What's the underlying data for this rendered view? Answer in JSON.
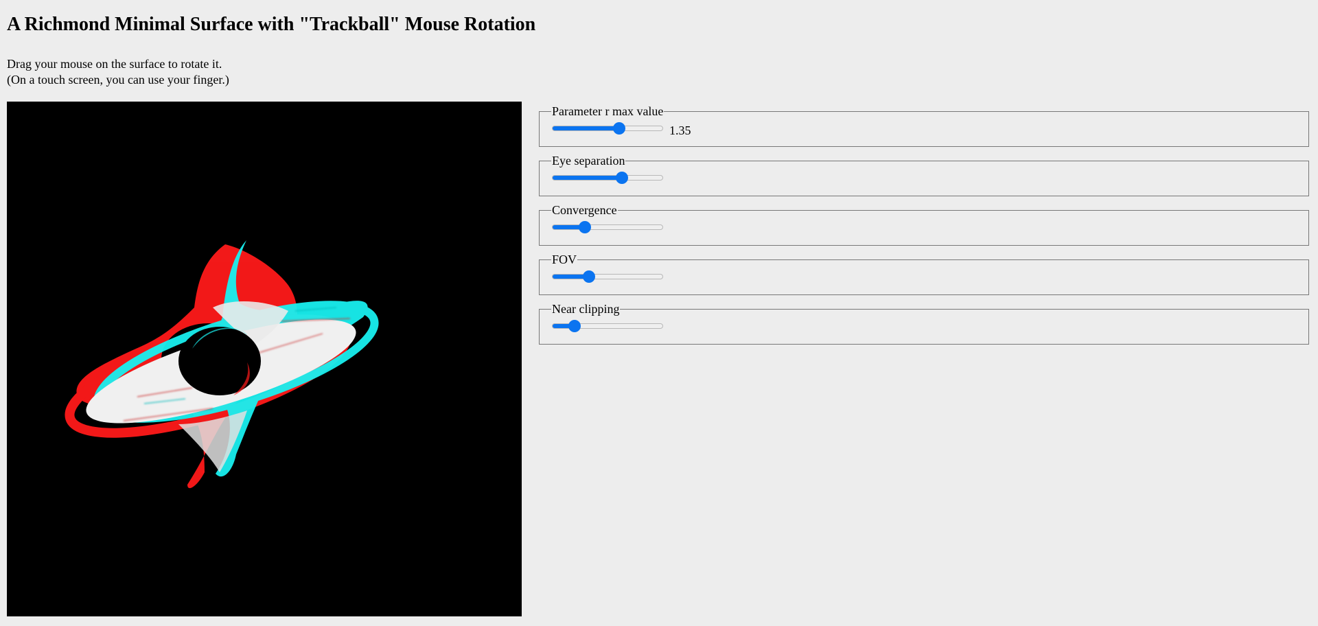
{
  "page": {
    "title": "A Richmond Minimal Surface with \"Trackball\" Mouse Rotation",
    "intro_line1": "Drag your mouse on the surface to rotate it.",
    "intro_line2": "(On a touch screen, you can use your finger.)"
  },
  "colors": {
    "background": "#ededed",
    "canvas": "#000000",
    "slider_accent": "#0b74f0",
    "anaglyph_left": "#ff1a1a",
    "anaglyph_right": "#19f0f0",
    "surface_base": "#f0f0f0"
  },
  "controls": [
    {
      "legend": "Parameter r max value",
      "value": 0.62,
      "value_label": "1.35"
    },
    {
      "legend": "Eye separation",
      "value": 0.65
    },
    {
      "legend": "Convergence",
      "value": 0.27
    },
    {
      "legend": "FOV",
      "value": 0.31
    },
    {
      "legend": "Near clipping",
      "value": 0.16
    }
  ]
}
